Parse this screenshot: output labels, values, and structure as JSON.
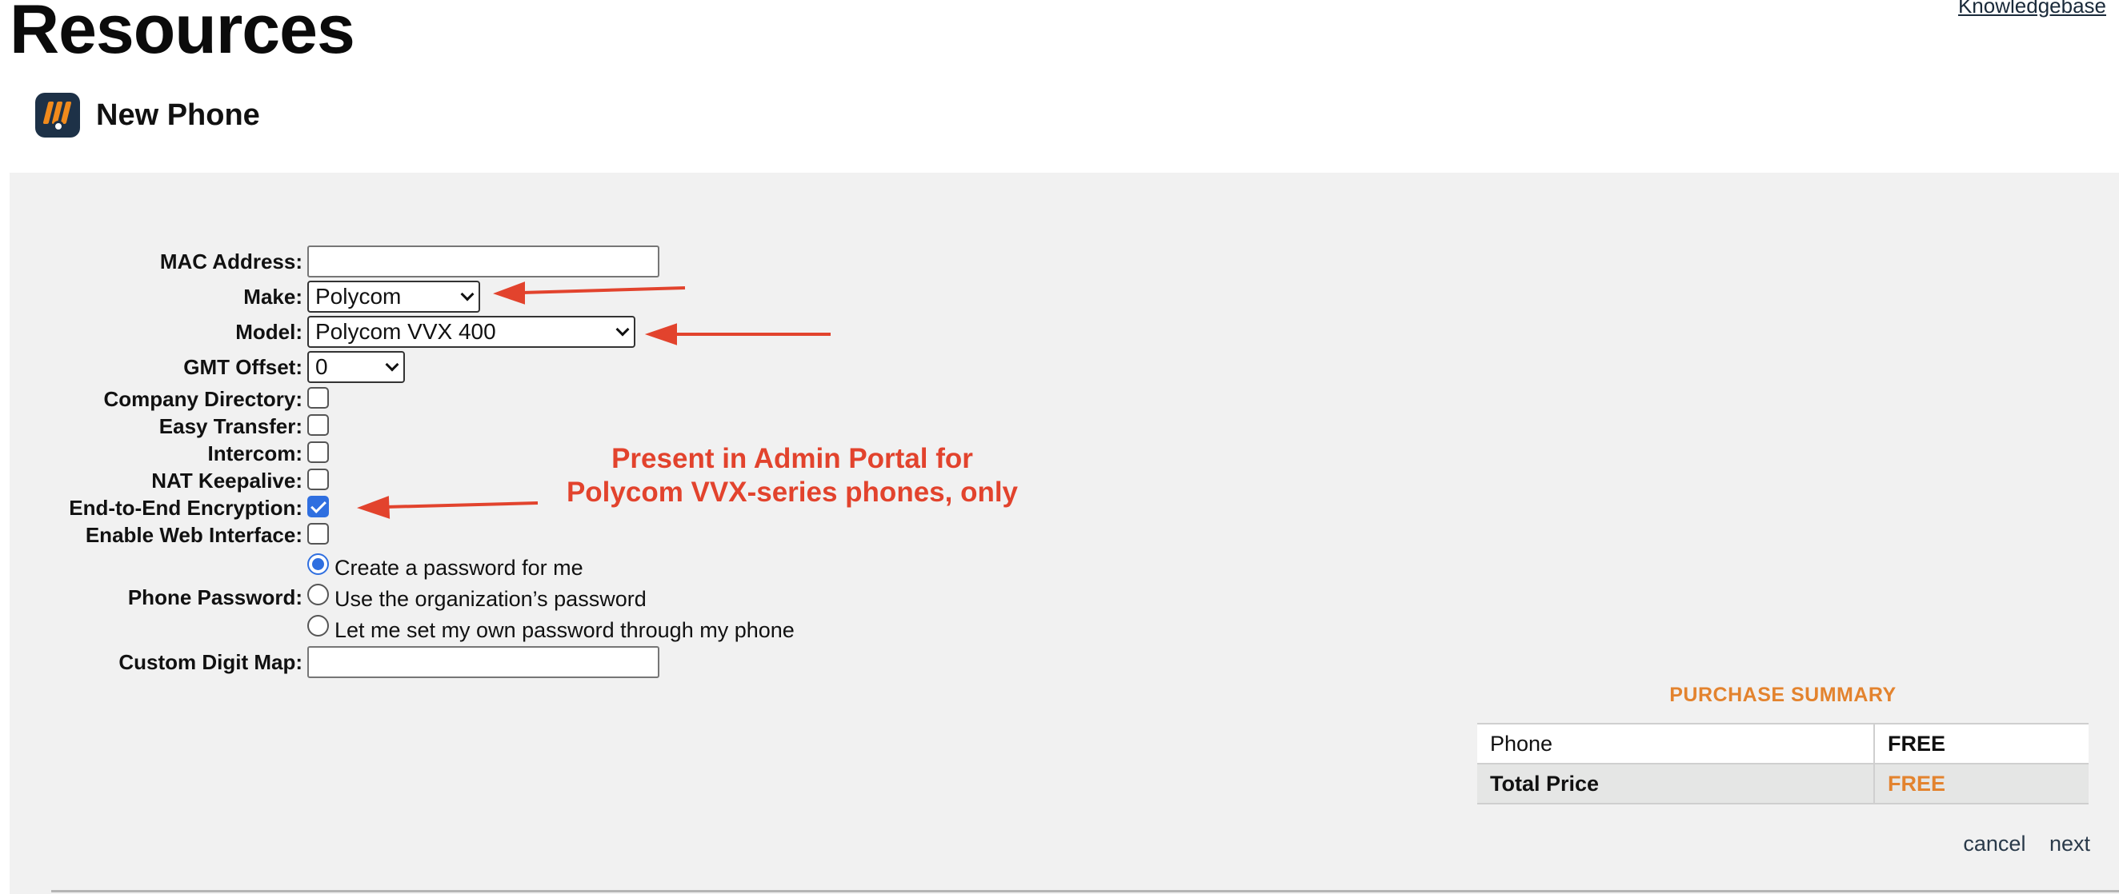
{
  "header": {
    "page_heading": "Resources",
    "knowledgebase_link": "Knowledgebase",
    "subtitle": "New Phone",
    "logo_icon": "phone-app-logo-icon"
  },
  "form": {
    "mac_label": "MAC Address:",
    "mac_value": "",
    "make_label": "Make:",
    "make_value": "Polycom",
    "model_label": "Model:",
    "model_value": "Polycom VVX 400",
    "gmt_label": "GMT Offset:",
    "gmt_value": "0",
    "company_directory_label": "Company Directory:",
    "company_directory_checked": false,
    "easy_transfer_label": "Easy Transfer:",
    "easy_transfer_checked": false,
    "intercom_label": "Intercom:",
    "intercom_checked": false,
    "nat_label": "NAT Keepalive:",
    "nat_checked": false,
    "e2e_label": "End-to-End Encryption:",
    "e2e_checked": true,
    "web_ui_label": "Enable Web Interface:",
    "web_ui_checked": false,
    "password_label": "Phone Password:",
    "password_options": [
      "Create a password for me",
      "Use the organization’s password",
      "Let me set my own password through my phone"
    ],
    "password_selected_index": 0,
    "digit_map_label": "Custom Digit Map:",
    "digit_map_value": ""
  },
  "annotation": {
    "line1": "Present in Admin Portal for",
    "line2": "Polycom VVX-series phones, only",
    "color": "#e2432d"
  },
  "summary": {
    "title": "PURCHASE SUMMARY",
    "rows": [
      {
        "name": "Phone",
        "value": "FREE"
      },
      {
        "name": "Total Price",
        "value": "FREE"
      }
    ],
    "accent": "#e3832e"
  },
  "actions": {
    "cancel": "cancel",
    "next": "next"
  }
}
